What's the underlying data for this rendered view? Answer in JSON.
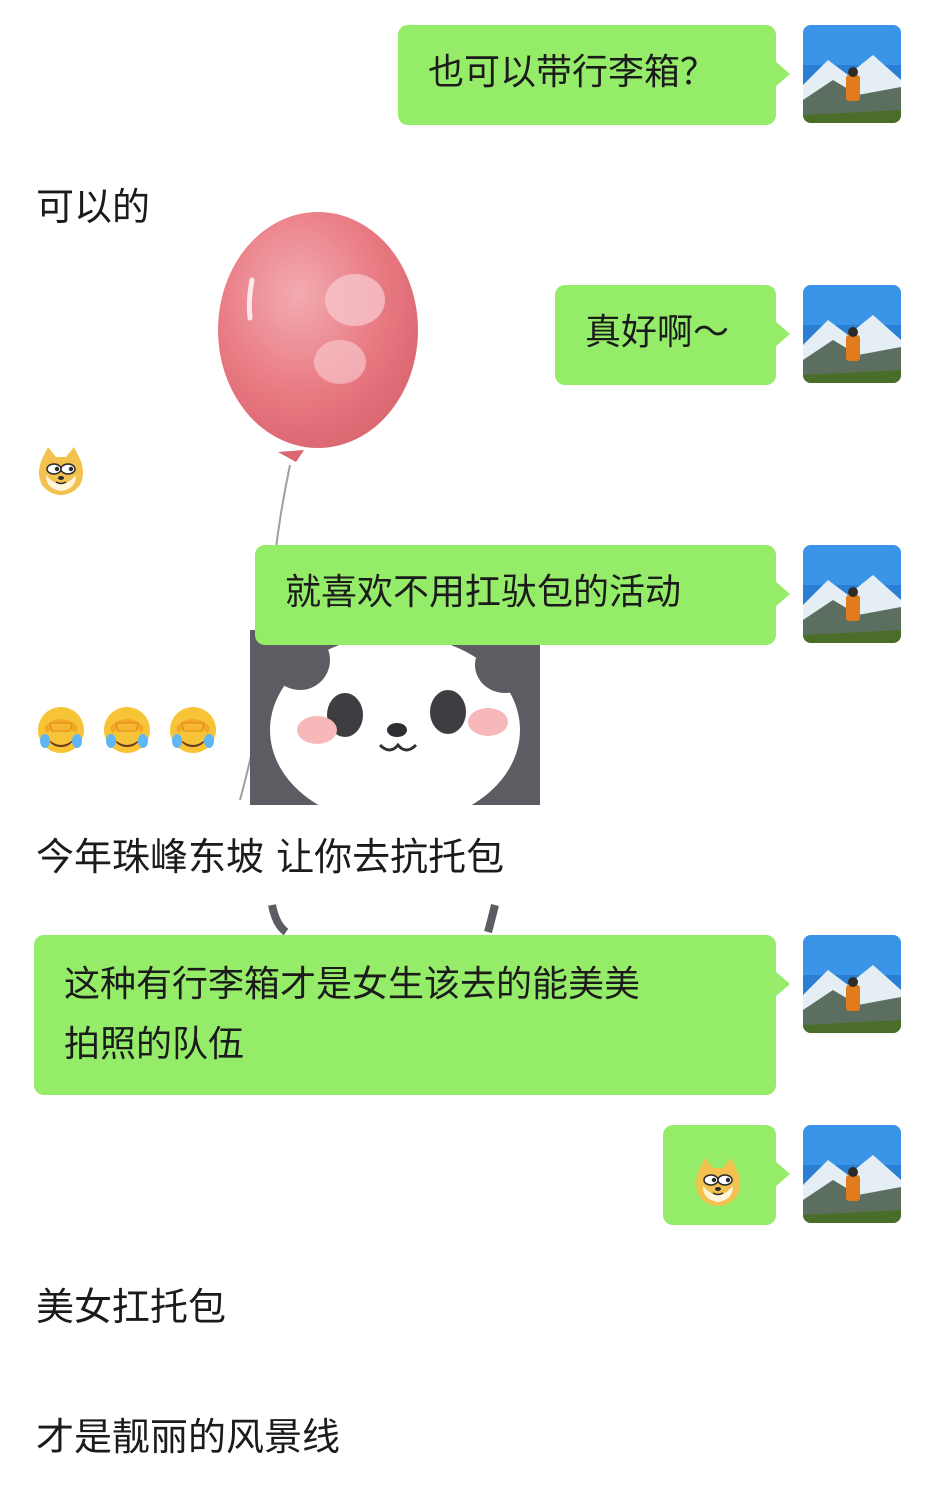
{
  "chat": {
    "messages": [
      {
        "side": "right",
        "text": "也可以带行李箱？"
      },
      {
        "side": "left",
        "text": "可以的"
      },
      {
        "side": "right",
        "text": "真好啊～"
      },
      {
        "side": "left",
        "emoji": [
          "doge-emoji"
        ]
      },
      {
        "side": "right",
        "text": "就喜欢不用扛驮包的活动"
      },
      {
        "side": "left",
        "emoji": [
          "facepalm-laugh-emoji",
          "facepalm-laugh-emoji",
          "facepalm-laugh-emoji"
        ]
      },
      {
        "side": "left",
        "text": "今年珠峰东坡 让你去抗托包"
      },
      {
        "side": "right",
        "text_line1": "这种有行李箱才是女生该去的能美美",
        "text_line2": "拍照的队伍"
      },
      {
        "side": "right",
        "emoji": [
          "doge-emoji"
        ]
      },
      {
        "side": "left",
        "text": "美女扛托包"
      },
      {
        "side": "left",
        "text": "才是靓丽的风景线"
      }
    ]
  },
  "colors": {
    "bubble_green": "#95ec69",
    "background": "#ffffff",
    "text": "#1b1b1b"
  }
}
